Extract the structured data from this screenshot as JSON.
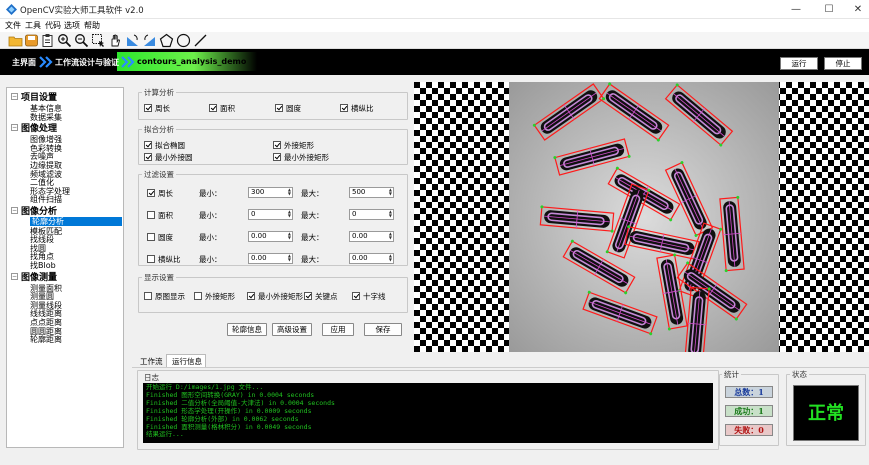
{
  "window": {
    "title": "OpenCV实验大师工具软件 v2.0",
    "min": "—",
    "max": "☐",
    "close": "✕"
  },
  "menu": [
    "文件",
    "工具",
    "代码",
    "选项",
    "帮助"
  ],
  "toolbar_icons": [
    "open-folder-icon",
    "save-icon",
    "clipboard-icon",
    "zoom-in-icon",
    "zoom-out-icon",
    "select-rect-icon",
    "hand-icon",
    "rotate-left-icon",
    "rotate-right-icon",
    "polygon-icon",
    "circle-icon",
    "line-icon"
  ],
  "banner": {
    "home": "主界面",
    "workflow": "工作流设计与验证",
    "project": "contours_analysis_demo",
    "run": "运行",
    "stop": "停止"
  },
  "tree": {
    "groups": [
      {
        "label": "项目设置",
        "items": [
          "基本信息",
          "数据采集"
        ]
      },
      {
        "label": "图像处理",
        "items": [
          "图像增强",
          "色彩转换",
          "去噪声",
          "边缘提取",
          "频域滤波",
          "二值化",
          "形态学处理",
          "组件扫描"
        ]
      },
      {
        "label": "图像分析",
        "items": [
          "轮廓分析",
          "模板匹配",
          "找线段",
          "找圆",
          "找角点",
          "找Blob"
        ]
      },
      {
        "label": "图像测量",
        "items": [
          "测量面积",
          "测量圆",
          "测量线段",
          "线线距离",
          "点点距离",
          "圆圆距离",
          "轮廓距离"
        ]
      }
    ],
    "selected": "轮廓分析"
  },
  "calc": {
    "title": "计算分析",
    "items": [
      {
        "label": "周长",
        "checked": true
      },
      {
        "label": "面积",
        "checked": true
      },
      {
        "label": "圆度",
        "checked": true
      },
      {
        "label": "横纵比",
        "checked": true
      }
    ]
  },
  "fit": {
    "title": "拟合分析",
    "items": [
      {
        "label": "拟合椭圆",
        "checked": true
      },
      {
        "label": "外接矩形",
        "checked": true
      },
      {
        "label": "最小外接圆",
        "checked": true
      },
      {
        "label": "最小外接矩形",
        "checked": true
      }
    ]
  },
  "filter": {
    "title": "过滤设置",
    "min_label": "最小：",
    "max_label": "最大：",
    "rows": [
      {
        "label": "周长",
        "checked": true,
        "min": "300",
        "max": "500"
      },
      {
        "label": "面积",
        "checked": false,
        "min": "0",
        "max": "0"
      },
      {
        "label": "圆度",
        "checked": false,
        "min": "0.00",
        "max": "0.00"
      },
      {
        "label": "横纵比",
        "checked": false,
        "min": "0.00",
        "max": "0.00"
      }
    ]
  },
  "display": {
    "title": "显示设置",
    "items": [
      {
        "label": "原图显示",
        "checked": false
      },
      {
        "label": "外接矩形",
        "checked": false
      },
      {
        "label": "最小外接矩形",
        "checked": true
      },
      {
        "label": "关键点",
        "checked": true
      },
      {
        "label": "十字线",
        "checked": true
      }
    ]
  },
  "actions": {
    "contour_info": "轮廓信息",
    "advanced": "高级设置",
    "apply": "应用",
    "save": "保存"
  },
  "bottom_tabs": [
    "工作流",
    "运行信息"
  ],
  "log": {
    "title": "日志",
    "lines": [
      "开始运行 D:/images/1.jpg 文件...",
      "Finished 图形空间转换(GRAY) in 0.0004 seconds",
      "Finished 二值分析(全局阈值-大津法) in 0.0004 seconds",
      "Finished 形态学处理(开操作) in 0.0009 seconds",
      "Finished 轮廓分析(外部) in 0.0062 seconds",
      "Finished 面积测量(格林积分) in 0.0049 seconds",
      "结果运行..."
    ]
  },
  "stats": {
    "title": "统计",
    "total": "总数：1",
    "success": "成功：1",
    "fail": "失败：0"
  },
  "status": {
    "title": "状态",
    "value": "正常"
  },
  "colors": {
    "accent_green": "#2de62d",
    "selection": "#0078d7",
    "log_text": "#20c020",
    "contour_box": "#ff1a1a"
  }
}
